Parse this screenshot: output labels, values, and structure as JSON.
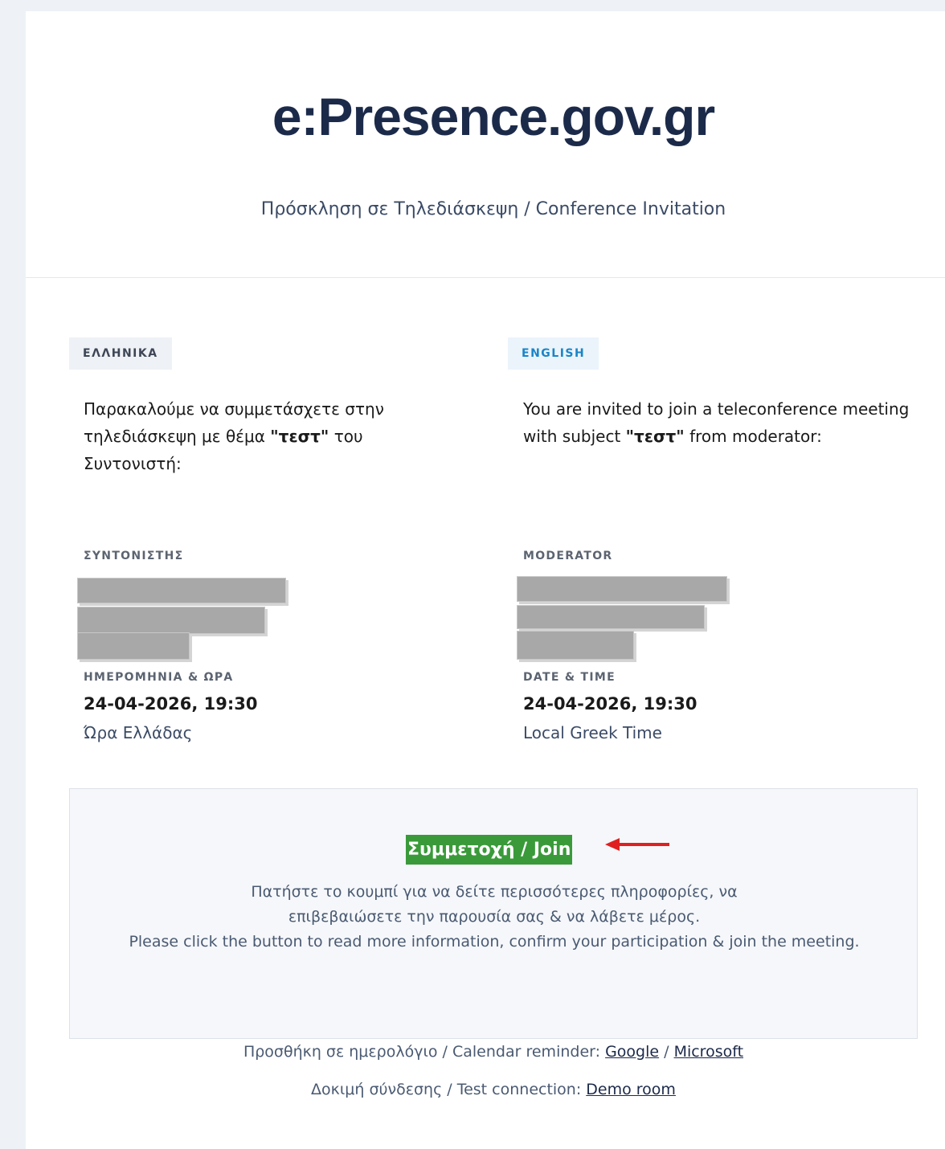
{
  "header": {
    "brand": "e:Presence.gov.gr",
    "subtitle": "Πρόσκληση σε Τηλεδιάσκεψη / Conference Invitation"
  },
  "greek": {
    "badge": "ΕΛΛΗΝΙΚΑ",
    "intro_before": "Παρακαλούμε να συμμετάσχετε στην τηλεδιάσκεψη με θέμα ",
    "subject": "\"τεστ\"",
    "intro_after": " του Συντονιστή:",
    "moderator_label": "ΣΥΝΤΟΝΙΣΤΗΣ",
    "datetime_label": "ΗΜΕΡΟΜΗΝΙΑ & ΩΡΑ",
    "datetime": "24-04-2026, 19:30",
    "timezone": "Ώρα Ελλάδας"
  },
  "english": {
    "badge": "ENGLISH",
    "intro_before": "You are invited to join a teleconference meeting with subject ",
    "subject": "\"τεστ\"",
    "intro_after": " from moderator:",
    "moderator_label": "MODERATOR",
    "datetime_label": "DATE & TIME",
    "datetime": "24-04-2026, 19:30",
    "timezone": "Local Greek Time"
  },
  "join": {
    "button_label": "Συμμετοχή / Join",
    "info_greek": "Πατήστε το κουμπί για να δείτε περισσότερες πληροφορίες, να επιβεβαιώσετε την παρουσία σας & να λάβετε μέρος.",
    "info_english": "Please click the button to read more information, confirm your participation & join the meeting."
  },
  "footer": {
    "calendar_prefix": "Προσθήκη σε ημερολόγιο / Calendar reminder: ",
    "google_link": "Google",
    "separator": " / ",
    "microsoft_link": "Microsoft",
    "test_prefix": "Δοκιμή σύνδεσης / Test connection: ",
    "demo_link": "Demo room"
  },
  "colors": {
    "join_button": "#3a9a3a",
    "annotation_arrow": "#e02020",
    "brand_text": "#1c2a4a",
    "english_badge_text": "#1a85c8"
  }
}
